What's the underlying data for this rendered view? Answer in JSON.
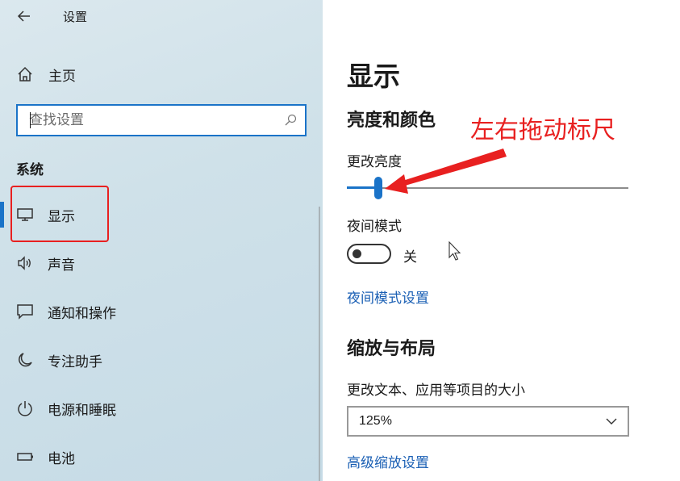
{
  "window": {
    "title": "设置"
  },
  "sidebar": {
    "home_label": "主页",
    "search_placeholder": "查找设置",
    "section_title": "系统",
    "items": [
      {
        "label": "显示",
        "icon": "monitor-icon",
        "selected": true
      },
      {
        "label": "声音",
        "icon": "speaker-icon"
      },
      {
        "label": "通知和操作",
        "icon": "notification-icon"
      },
      {
        "label": "专注助手",
        "icon": "moon-icon"
      },
      {
        "label": "电源和睡眠",
        "icon": "power-icon"
      },
      {
        "label": "电池",
        "icon": "battery-icon"
      }
    ]
  },
  "main": {
    "title": "显示",
    "brightness_section": "亮度和颜色",
    "brightness_label": "更改亮度",
    "brightness_value": 0.12,
    "night_mode_label": "夜间模式",
    "night_mode_state": "关",
    "night_mode_settings_link": "夜间模式设置",
    "scale_section": "缩放与布局",
    "scale_label": "更改文本、应用等项目的大小",
    "scale_value": "125%",
    "advanced_scale_link": "高级缩放设置"
  },
  "annotation": {
    "text": "左右拖动标尺",
    "color": "#e82020"
  },
  "colors": {
    "accent": "#1a73c8",
    "link": "#1a5fb4",
    "annotation": "#e82020"
  }
}
